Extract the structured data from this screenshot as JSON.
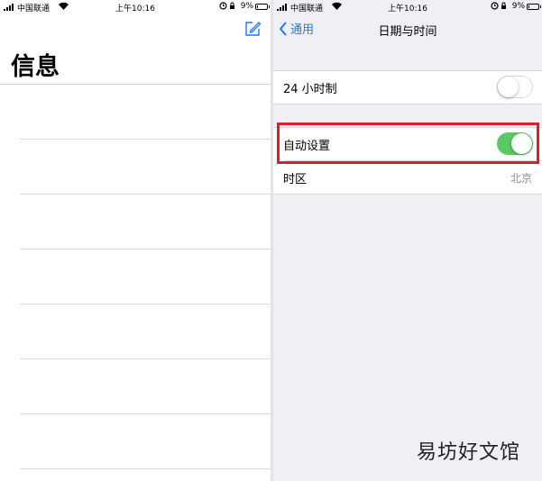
{
  "left": {
    "status": {
      "carrier": "中国联通",
      "time": "上午10:16",
      "battery": "9%",
      "battery_level": 0.09
    },
    "title": "信息",
    "rows": 7
  },
  "right": {
    "status": {
      "carrier": "中国联通",
      "time": "上午10:16",
      "battery": "9%",
      "battery_level": 0.09
    },
    "nav": {
      "back_label": "通用",
      "title": "日期与时间"
    },
    "settings": {
      "hour24": {
        "label": "24 小时制",
        "on": false
      },
      "auto_set": {
        "label": "自动设置",
        "on": true
      },
      "timezone": {
        "label": "时区",
        "value": "北京"
      }
    }
  },
  "watermark": "易坊好文馆",
  "colors": {
    "ios_blue": "#1a7af8",
    "toggle_on": "#57c965",
    "highlight": "#d8212c"
  },
  "icons": [
    "cellular-signal-icon",
    "wifi-icon",
    "alarm-icon",
    "rotation-lock-icon",
    "battery-icon",
    "compose-icon",
    "chevron-left-icon"
  ]
}
